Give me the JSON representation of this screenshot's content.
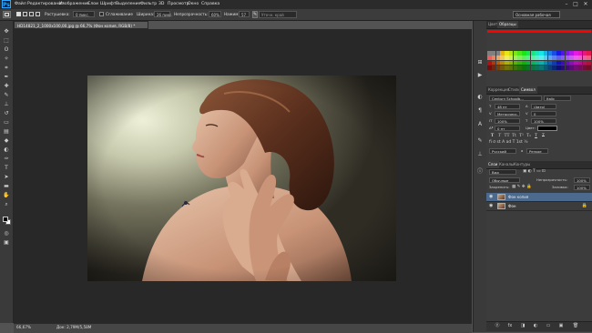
{
  "app": {
    "logo": "Ps",
    "menu": [
      "Файл",
      "Редактирование",
      "Изображение",
      "Слои",
      "Шрифт",
      "Выделение",
      "Фильтр",
      "3D",
      "Просмотр",
      "Окно",
      "Справка"
    ],
    "window_controls": [
      "–",
      "□",
      "✕"
    ]
  },
  "options": {
    "feather_label": "Растушевка:",
    "feather_value": "0 пикс.",
    "antialias_label": "Сглаживание",
    "style_label": "Стиль:",
    "width_label": "Ширина:",
    "width_value": "26 пикс.",
    "opacity_label": "Непрозрачность:",
    "opacity_value": "60%",
    "contrast_label": "Нажим:",
    "contrast_value": "57",
    "search_placeholder": "Уточн. край",
    "workspace": "Основная рабочая среда"
  },
  "document": {
    "tab_title": "HD14821_2_1000x100,00.jpg @ 66,7% (Фон копия, RGB/8) *",
    "zoom": "66,67%",
    "info": "Док: 2,79М/5,58М"
  },
  "panels": {
    "swatches_tabs": [
      "Цвет",
      "Образцы"
    ],
    "character_tabs": [
      "Коррекция",
      "Стили",
      "Символ"
    ],
    "font_family": "Century Schoolb...",
    "font_style": "Italic",
    "font_size": "48 пт",
    "leading": "(Авто)",
    "kerning": "Метрическ.",
    "tracking": "0",
    "vscale": "100%",
    "hscale": "100%",
    "baseline": "0 пт",
    "color_label": "Цвет:",
    "language": "Русский",
    "antialias": "Резкое",
    "aa_icon": "a",
    "type_buttons": [
      "T",
      "T",
      "TT",
      "Tt",
      "T¹",
      "T₁",
      "T",
      "T"
    ],
    "layers_tabs": [
      "Слои",
      "Каналы",
      "Контуры"
    ],
    "kind": "Вид",
    "blend_mode": "Обычные",
    "opacity_label": "Непрозрачность:",
    "opacity_value": "100%",
    "lock_label": "Закрепить:",
    "fill_label": "Заливка:",
    "fill_value": "100%",
    "layers": [
      {
        "name": "Фон копия",
        "selected": true,
        "locked": false
      },
      {
        "name": "Фон",
        "selected": false,
        "locked": true
      }
    ],
    "footer_icons": [
      "ⓖ",
      "fx",
      "◨",
      "◐",
      "▭",
      "▣",
      "🗑"
    ]
  },
  "colors": {
    "accent": "#31a8ff",
    "selected_layer": "#4b6a8e",
    "canvas_bg": "#282828"
  }
}
